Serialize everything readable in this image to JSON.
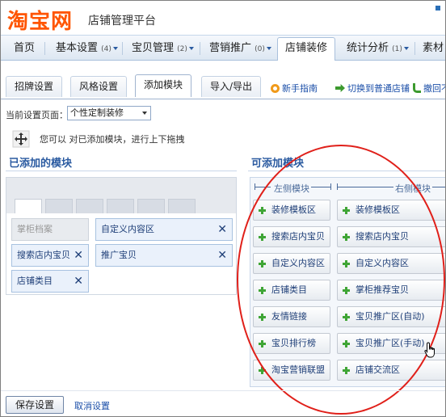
{
  "header": {
    "logo": "淘宝网",
    "platform_title": "店铺管理平台"
  },
  "nav": {
    "items": [
      {
        "label": "首页",
        "count": ""
      },
      {
        "label": "基本设置",
        "count": "(4)"
      },
      {
        "label": "宝贝管理",
        "count": "(2)"
      },
      {
        "label": "营销推广",
        "count": "(0)"
      },
      {
        "label": "店铺装修",
        "count": ""
      },
      {
        "label": "统计分析",
        "count": "(1)"
      },
      {
        "label": "素材",
        "count": ""
      }
    ],
    "active": "店铺装修"
  },
  "subtabs": {
    "items": [
      "招牌设置",
      "风格设置",
      "添加模块",
      "导入/导出"
    ],
    "active": "添加模块",
    "links": [
      "新手指南",
      "切换到普通店铺",
      "撤回不"
    ]
  },
  "current_page": {
    "label": "当前设置页面：",
    "selected": "个性定制装修"
  },
  "hint": "您可以 对已添加模块，进行上下拖拽",
  "added_section": {
    "title": "已添加的模块",
    "modules": [
      {
        "label": "掌柜档案",
        "removable": false
      },
      {
        "label": "自定义内容区",
        "removable": true
      },
      {
        "label": "搜索店内宝贝",
        "removable": true
      },
      {
        "label": "推广宝贝",
        "removable": true
      },
      {
        "label": "店铺类目",
        "removable": true
      }
    ],
    "remove_symbol": "✕"
  },
  "addable_section": {
    "title": "可添加模块",
    "left_column": {
      "header": "左侧模块",
      "items": [
        "装修模板区",
        "搜索店内宝贝",
        "自定义内容区",
        "店铺类目",
        "友情链接",
        "宝贝排行榜",
        "淘宝营销联盟"
      ]
    },
    "right_column": {
      "header": "右侧模块",
      "items": [
        "装修模板区",
        "搜索店内宝贝",
        "自定义内容区",
        "掌柜推荐宝贝",
        "宝贝推广区(自动)",
        "宝贝推广区(手动)",
        "店铺交流区"
      ]
    }
  },
  "footer": {
    "save_label": "保存设置",
    "cancel_label": "取消设置"
  },
  "colors": {
    "logo": "#ff5500",
    "link": "#1a4ea8",
    "section_title": "#2a5aa0",
    "annotation": "#e0201a",
    "plus": "#3fa535"
  }
}
